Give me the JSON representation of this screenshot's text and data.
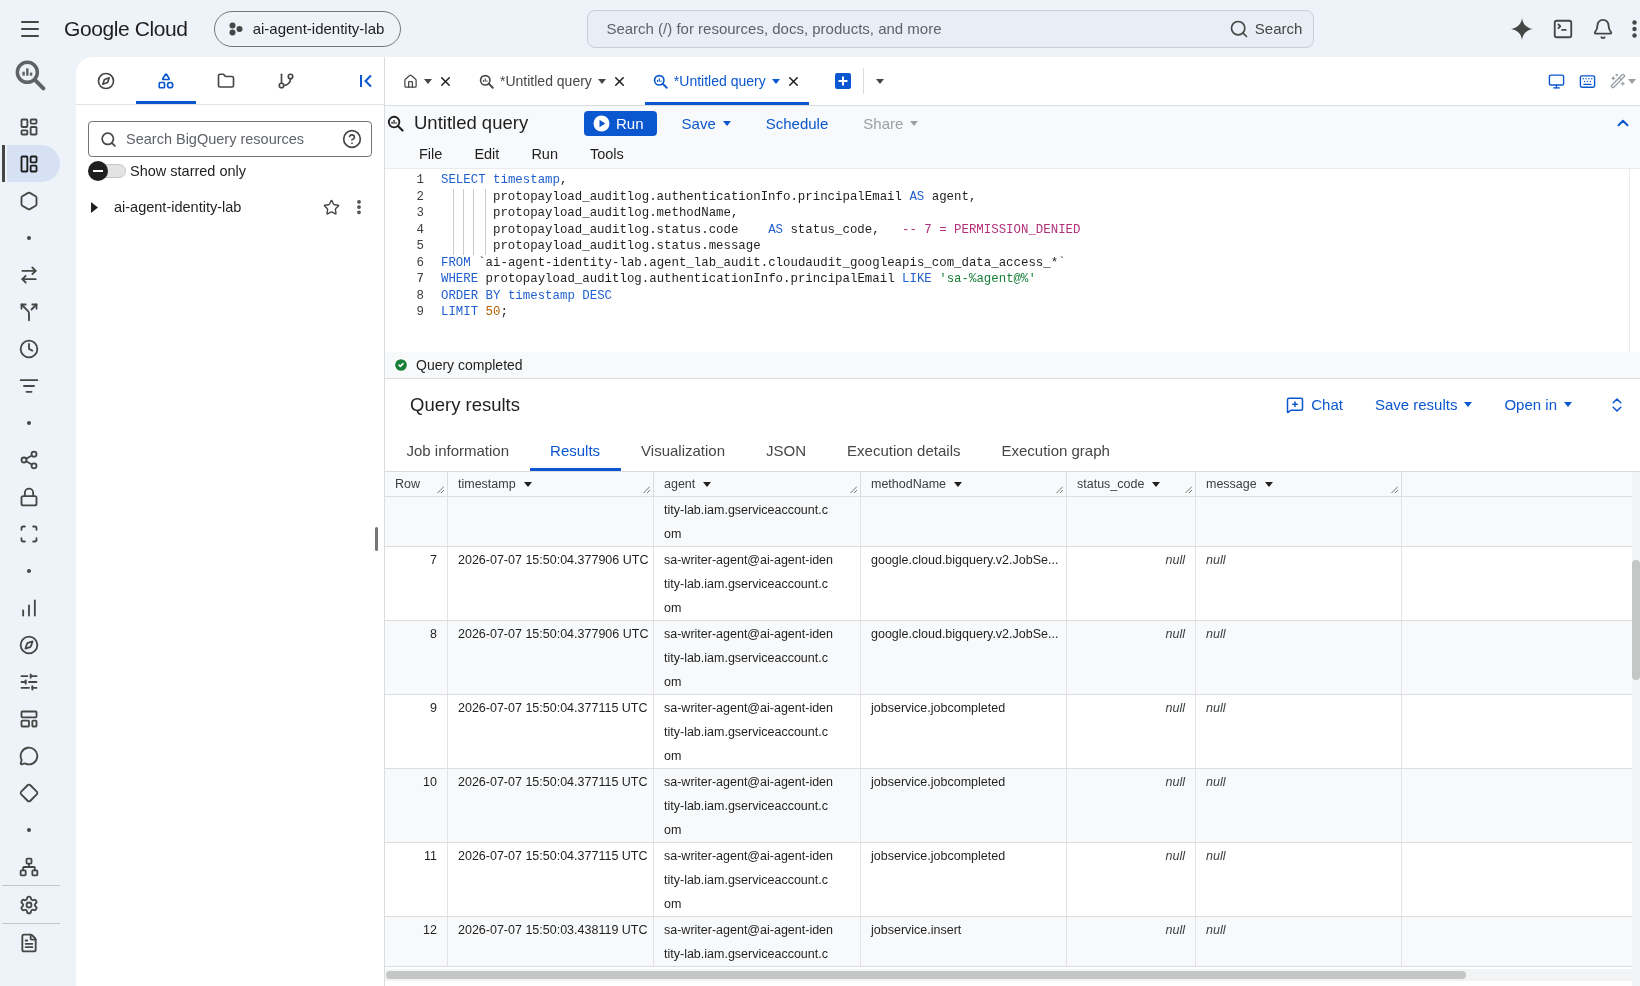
{
  "top_bar": {
    "logo": "Google Cloud",
    "project": "ai-agent-identity-lab",
    "search": {
      "placeholder": "Search (/) for resources, docs, products, and more",
      "button": "Search"
    }
  },
  "nav_rail": {
    "items": [
      {
        "kind": "button",
        "selected": false
      },
      {
        "kind": "button",
        "selected": true
      },
      {
        "kind": "button",
        "selected": false
      },
      {
        "kind": "dot"
      },
      {
        "kind": "button",
        "selected": false
      },
      {
        "kind": "button",
        "selected": false
      },
      {
        "kind": "button",
        "selected": false
      },
      {
        "kind": "button",
        "selected": false
      },
      {
        "kind": "dot"
      },
      {
        "kind": "button",
        "selected": false
      },
      {
        "kind": "button",
        "selected": false
      },
      {
        "kind": "button",
        "selected": false
      },
      {
        "kind": "dot"
      },
      {
        "kind": "button",
        "selected": false
      },
      {
        "kind": "button",
        "selected": false
      },
      {
        "kind": "button",
        "selected": false
      },
      {
        "kind": "button",
        "selected": false
      },
      {
        "kind": "button",
        "selected": false
      },
      {
        "kind": "button",
        "selected": false
      },
      {
        "kind": "dot"
      },
      {
        "kind": "button",
        "selected": false
      },
      {
        "kind": "line"
      },
      {
        "kind": "button",
        "selected": false
      },
      {
        "kind": "line"
      },
      {
        "kind": "button",
        "selected": false
      }
    ]
  },
  "explorer": {
    "tabs": [
      {
        "selected": false
      },
      {
        "selected": true
      },
      {
        "selected": false
      },
      {
        "selected": false
      }
    ],
    "search": {
      "placeholder": "Search BigQuery resources"
    },
    "starred_filter": {
      "label": "Show starred only",
      "on": false
    },
    "tree": [
      {
        "label": "ai-agent-identity-lab",
        "expanded": false,
        "starred": false
      }
    ]
  },
  "editor_tabs": [
    {
      "kind": "home",
      "selected": false
    },
    {
      "kind": "query",
      "label": "*Untitled query",
      "selected": false
    },
    {
      "kind": "query",
      "label": "*Untitled query",
      "selected": true
    }
  ],
  "query": {
    "title": "Untitled query",
    "actions": [
      {
        "label": "Run",
        "kind": "primary",
        "disabled": false
      },
      {
        "label": "Save",
        "kind": "menu",
        "disabled": false
      },
      {
        "label": "Schedule",
        "kind": "text",
        "disabled": false
      },
      {
        "label": "Share",
        "kind": "menu",
        "disabled": true
      }
    ],
    "menu": [
      "File",
      "Edit",
      "Run",
      "Tools"
    ],
    "lines": [
      {
        "number": "1",
        "indented": false,
        "tokens": [
          {
            "kind": "keyword",
            "text": "SELECT timestamp"
          },
          {
            "kind": "plain",
            "text": ","
          }
        ]
      },
      {
        "number": "2",
        "indented": true,
        "tokens": [
          {
            "kind": "plain",
            "text": "protopayload_auditlog.authenticationInfo.principalEmail "
          },
          {
            "kind": "keyword",
            "text": "AS"
          },
          {
            "kind": "plain",
            "text": " agent,"
          }
        ]
      },
      {
        "number": "3",
        "indented": true,
        "tokens": [
          {
            "kind": "plain",
            "text": "protopayload_auditlog.methodName,"
          }
        ]
      },
      {
        "number": "4",
        "indented": true,
        "tokens": [
          {
            "kind": "plain",
            "text": "protopayload_auditlog.status.code    "
          },
          {
            "kind": "keyword",
            "text": "AS"
          },
          {
            "kind": "plain",
            "text": " status_code,   "
          },
          {
            "kind": "comment",
            "text": "-- 7 = PERMISSION_DENIED"
          }
        ]
      },
      {
        "number": "5",
        "indented": true,
        "tokens": [
          {
            "kind": "plain",
            "text": "protopayload_auditlog.status.message"
          }
        ]
      },
      {
        "number": "6",
        "indented": false,
        "tokens": [
          {
            "kind": "keyword",
            "text": "FROM"
          },
          {
            "kind": "plain",
            "text": " `ai-agent-identity-lab.agent_lab_audit.cloudaudit_googleapis_com_data_access_*`"
          }
        ]
      },
      {
        "number": "7",
        "indented": false,
        "tokens": [
          {
            "kind": "keyword",
            "text": "WHERE"
          },
          {
            "kind": "plain",
            "text": " protopayload_auditlog.authenticationInfo.principalEmail "
          },
          {
            "kind": "keyword",
            "text": "LIKE"
          },
          {
            "kind": "string",
            "text": " 'sa-%agent@%'"
          }
        ]
      },
      {
        "number": "8",
        "indented": false,
        "tokens": [
          {
            "kind": "keyword",
            "text": "ORDER BY timestamp DESC"
          }
        ]
      },
      {
        "number": "9",
        "indented": false,
        "tokens": [
          {
            "kind": "keyword",
            "text": "LIMIT"
          },
          {
            "kind": "number",
            "text": " 50"
          },
          {
            "kind": "plain",
            "text": ";"
          }
        ]
      }
    ],
    "status": {
      "kind": "success",
      "text": "Query completed"
    }
  },
  "results": {
    "title": "Query results",
    "actions": [
      {
        "label": "Chat",
        "kind": "chat"
      },
      {
        "label": "Save results",
        "kind": "menu"
      },
      {
        "label": "Open in",
        "kind": "menu"
      }
    ],
    "tabs": [
      {
        "label": "Job information",
        "selected": false
      },
      {
        "label": "Results",
        "selected": true
      },
      {
        "label": "Visualization",
        "selected": false
      },
      {
        "label": "JSON",
        "selected": false
      },
      {
        "label": "Execution details",
        "selected": false
      },
      {
        "label": "Execution graph",
        "selected": false
      }
    ],
    "table": {
      "columns": [
        {
          "label": "Row",
          "kind": "row_number"
        },
        {
          "label": "timestamp",
          "kind": "field"
        },
        {
          "label": "agent",
          "kind": "field"
        },
        {
          "label": "methodName",
          "kind": "field"
        },
        {
          "label": "status_code",
          "kind": "numeric_field"
        },
        {
          "label": "message",
          "kind": "field"
        }
      ],
      "scrolled_row_tail": {
        "agent": "tity-lab.iam.gserviceaccount.com"
      },
      "rows": [
        {
          "cells": [
            {
              "text": "7",
              "is_null": false
            },
            {
              "text": "2026-07-07 15:50:04.377906 UTC",
              "is_null": false
            },
            {
              "text": "sa-writer-agent@ai-agent-identity-lab.iam.gserviceaccount.com",
              "is_null": false
            },
            {
              "text": "google.cloud.bigquery.v2.JobSe...",
              "is_null": false
            },
            {
              "text": "null",
              "is_null": true
            },
            {
              "text": "null",
              "is_null": true
            }
          ]
        },
        {
          "cells": [
            {
              "text": "8",
              "is_null": false
            },
            {
              "text": "2026-07-07 15:50:04.377906 UTC",
              "is_null": false
            },
            {
              "text": "sa-writer-agent@ai-agent-identity-lab.iam.gserviceaccount.com",
              "is_null": false
            },
            {
              "text": "google.cloud.bigquery.v2.JobSe...",
              "is_null": false
            },
            {
              "text": "null",
              "is_null": true
            },
            {
              "text": "null",
              "is_null": true
            }
          ]
        },
        {
          "cells": [
            {
              "text": "9",
              "is_null": false
            },
            {
              "text": "2026-07-07 15:50:04.377115 UTC",
              "is_null": false
            },
            {
              "text": "sa-writer-agent@ai-agent-identity-lab.iam.gserviceaccount.com",
              "is_null": false
            },
            {
              "text": "jobservice.jobcompleted",
              "is_null": false
            },
            {
              "text": "null",
              "is_null": true
            },
            {
              "text": "null",
              "is_null": true
            }
          ]
        },
        {
          "cells": [
            {
              "text": "10",
              "is_null": false
            },
            {
              "text": "2026-07-07 15:50:04.377115 UTC",
              "is_null": false
            },
            {
              "text": "sa-writer-agent@ai-agent-identity-lab.iam.gserviceaccount.com",
              "is_null": false
            },
            {
              "text": "jobservice.jobcompleted",
              "is_null": false
            },
            {
              "text": "null",
              "is_null": true
            },
            {
              "text": "null",
              "is_null": true
            }
          ]
        },
        {
          "cells": [
            {
              "text": "11",
              "is_null": false
            },
            {
              "text": "2026-07-07 15:50:04.377115 UTC",
              "is_null": false
            },
            {
              "text": "sa-writer-agent@ai-agent-identity-lab.iam.gserviceaccount.com",
              "is_null": false
            },
            {
              "text": "jobservice.jobcompleted",
              "is_null": false
            },
            {
              "text": "null",
              "is_null": true
            },
            {
              "text": "null",
              "is_null": true
            }
          ]
        },
        {
          "cells": [
            {
              "text": "12",
              "is_null": false
            },
            {
              "text": "2026-07-07 15:50:03.438119 UTC",
              "is_null": false
            },
            {
              "text": "sa-writer-agent@ai-agent-identity-lab.iam.gserviceaccount.c",
              "is_null": false
            },
            {
              "text": "jobservice.insert",
              "is_null": false
            },
            {
              "text": "null",
              "is_null": true
            },
            {
              "text": "null",
              "is_null": true
            }
          ]
        }
      ]
    }
  }
}
